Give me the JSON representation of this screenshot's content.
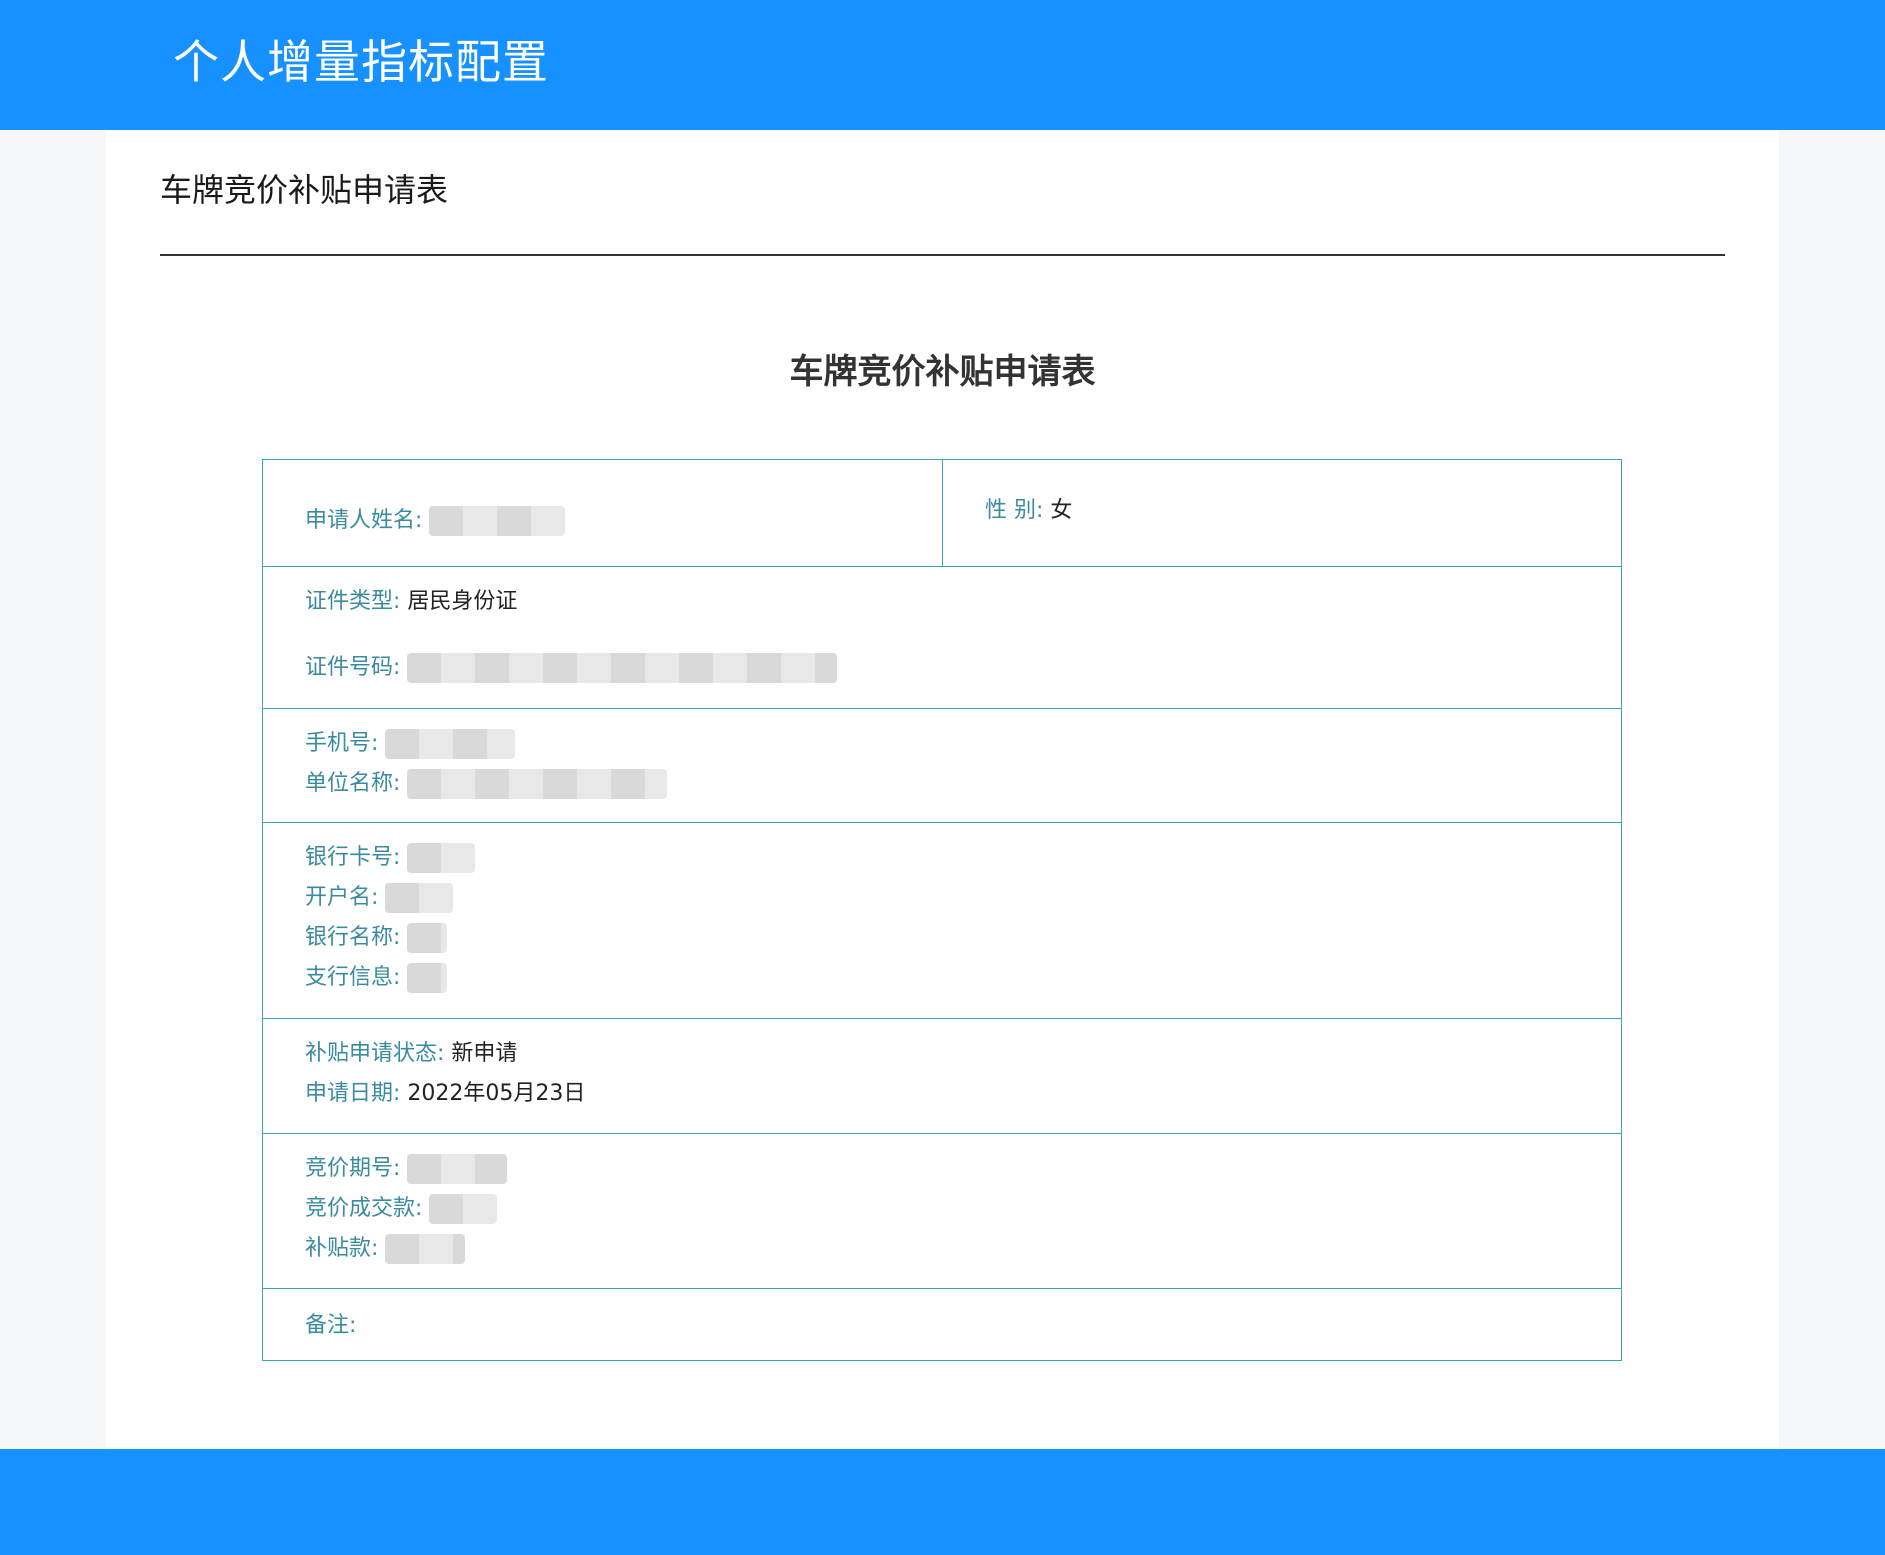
{
  "header": {
    "title": "个人增量指标配置"
  },
  "page": {
    "heading": "车牌竞价补贴申请表"
  },
  "form": {
    "title": "车牌竞价补贴申请表",
    "fields": {
      "applicant_name": {
        "label": "申请人姓名:",
        "value": ""
      },
      "gender": {
        "label": "性 别:",
        "value": "女"
      },
      "id_type": {
        "label": "证件类型:",
        "value": "居民身份证"
      },
      "id_number": {
        "label": "证件号码:",
        "value": ""
      },
      "phone": {
        "label": "手机号:",
        "value": ""
      },
      "employer": {
        "label": "单位名称:",
        "value": ""
      },
      "bank_card": {
        "label": "银行卡号:",
        "value": ""
      },
      "account_name": {
        "label": "开户名:",
        "value": ""
      },
      "bank_name": {
        "label": "银行名称:",
        "value": ""
      },
      "branch_info": {
        "label": "支行信息:",
        "value": ""
      },
      "status": {
        "label": "补贴申请状态:",
        "value": "新申请"
      },
      "apply_date": {
        "label": "申请日期:",
        "value": "2022年05月23日"
      },
      "bid_period": {
        "label": "竞价期号:",
        "value": ""
      },
      "bid_amount": {
        "label": "竞价成交款:",
        "value": ""
      },
      "subsidy": {
        "label": "补贴款:",
        "value": ""
      },
      "remark": {
        "label": "备注:",
        "value": ""
      }
    }
  }
}
